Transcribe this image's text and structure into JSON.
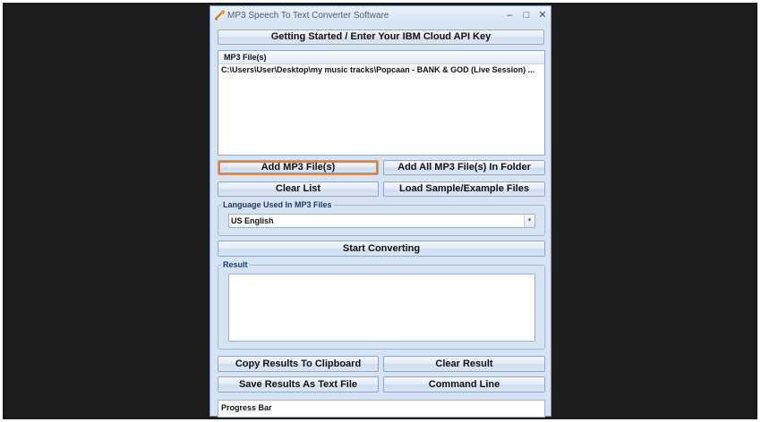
{
  "window": {
    "title": "MP3 Speech To Text Converter Software",
    "minimize_glyph": "–",
    "maximize_glyph": "□",
    "close_glyph": "✕"
  },
  "buttons": {
    "api_key": "Getting Started / Enter Your IBM Cloud API Key",
    "add_files": "Add MP3 File(s)",
    "add_folder": "Add All MP3 File(s) In Folder",
    "clear_list": "Clear List",
    "load_samples": "Load Sample/Example Files",
    "start_converting": "Start Converting",
    "copy_results": "Copy Results To Clipboard",
    "clear_result": "Clear Result",
    "save_results": "Save Results As Text File",
    "command_line": "Command Line"
  },
  "file_list": {
    "header": "MP3 File(s)",
    "rows": [
      "C:\\Users\\User\\Desktop\\my music tracks\\Popcaan - BANK & GOD (Live Session)  ..."
    ]
  },
  "language": {
    "label": "Language Used In MP3 Files",
    "selected": "US English",
    "arrow_glyph": "▾"
  },
  "result": {
    "label": "Result",
    "value": ""
  },
  "progress": {
    "label": "Progress Bar",
    "fraction": 0
  },
  "colors": {
    "window_bg": "#d6e3f3",
    "focus_outline": "#f07c32",
    "legend_text": "#1b3a6b"
  },
  "icons": {
    "app": "mp3-speech-app-icon"
  }
}
